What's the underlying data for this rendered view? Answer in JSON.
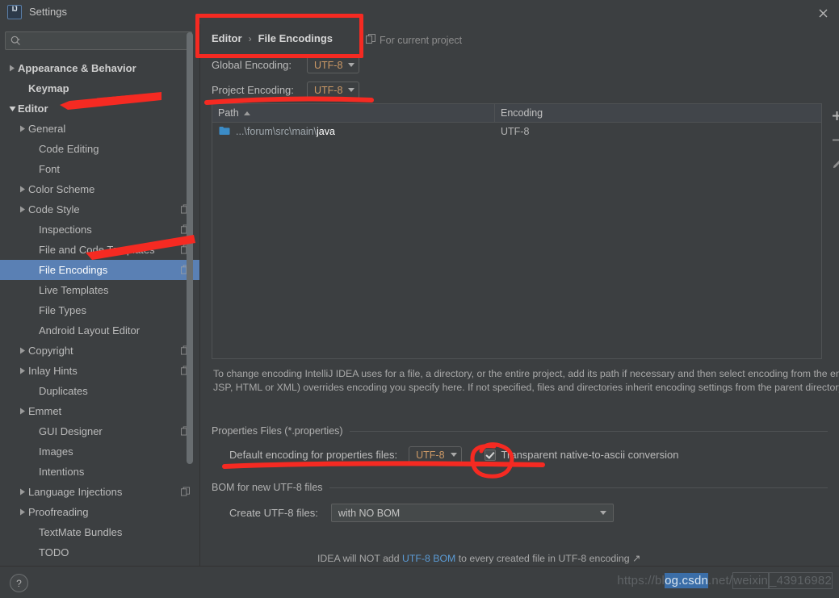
{
  "window": {
    "title": "Settings",
    "app_icon": "intellij-idea-icon",
    "close_icon": "close-icon"
  },
  "search": {
    "value": "",
    "placeholder": "",
    "icon": "search-icon"
  },
  "sidebar": {
    "scrollbar": "vertical-scrollbar",
    "items": [
      {
        "label": "Appearance & Behavior",
        "indent": 0,
        "arrow": "collapsed",
        "bold": true,
        "badge": false,
        "selected": false
      },
      {
        "label": "Keymap",
        "indent": 1,
        "arrow": "none",
        "bold": true,
        "badge": false,
        "selected": false
      },
      {
        "label": "Editor",
        "indent": 0,
        "arrow": "expanded",
        "bold": true,
        "badge": false,
        "selected": false
      },
      {
        "label": "General",
        "indent": 1,
        "arrow": "collapsed",
        "bold": false,
        "badge": false,
        "selected": false
      },
      {
        "label": "Code Editing",
        "indent": 2,
        "arrow": "none",
        "bold": false,
        "badge": false,
        "selected": false
      },
      {
        "label": "Font",
        "indent": 2,
        "arrow": "none",
        "bold": false,
        "badge": false,
        "selected": false
      },
      {
        "label": "Color Scheme",
        "indent": 1,
        "arrow": "collapsed",
        "bold": false,
        "badge": false,
        "selected": false
      },
      {
        "label": "Code Style",
        "indent": 1,
        "arrow": "collapsed",
        "bold": false,
        "badge": true,
        "selected": false
      },
      {
        "label": "Inspections",
        "indent": 2,
        "arrow": "none",
        "bold": false,
        "badge": true,
        "selected": false
      },
      {
        "label": "File and Code Templates",
        "indent": 2,
        "arrow": "none",
        "bold": false,
        "badge": true,
        "selected": false
      },
      {
        "label": "File Encodings",
        "indent": 2,
        "arrow": "none",
        "bold": false,
        "badge": true,
        "selected": true
      },
      {
        "label": "Live Templates",
        "indent": 2,
        "arrow": "none",
        "bold": false,
        "badge": false,
        "selected": false
      },
      {
        "label": "File Types",
        "indent": 2,
        "arrow": "none",
        "bold": false,
        "badge": false,
        "selected": false
      },
      {
        "label": "Android Layout Editor",
        "indent": 2,
        "arrow": "none",
        "bold": false,
        "badge": false,
        "selected": false
      },
      {
        "label": "Copyright",
        "indent": 1,
        "arrow": "collapsed",
        "bold": false,
        "badge": true,
        "selected": false
      },
      {
        "label": "Inlay Hints",
        "indent": 1,
        "arrow": "collapsed",
        "bold": false,
        "badge": true,
        "selected": false
      },
      {
        "label": "Duplicates",
        "indent": 2,
        "arrow": "none",
        "bold": false,
        "badge": false,
        "selected": false
      },
      {
        "label": "Emmet",
        "indent": 1,
        "arrow": "collapsed",
        "bold": false,
        "badge": false,
        "selected": false
      },
      {
        "label": "GUI Designer",
        "indent": 2,
        "arrow": "none",
        "bold": false,
        "badge": true,
        "selected": false
      },
      {
        "label": "Images",
        "indent": 2,
        "arrow": "none",
        "bold": false,
        "badge": false,
        "selected": false
      },
      {
        "label": "Intentions",
        "indent": 2,
        "arrow": "none",
        "bold": false,
        "badge": false,
        "selected": false
      },
      {
        "label": "Language Injections",
        "indent": 1,
        "arrow": "collapsed",
        "bold": false,
        "badge": true,
        "selected": false
      },
      {
        "label": "Proofreading",
        "indent": 1,
        "arrow": "collapsed",
        "bold": false,
        "badge": false,
        "selected": false
      },
      {
        "label": "TextMate Bundles",
        "indent": 2,
        "arrow": "none",
        "bold": false,
        "badge": false,
        "selected": false
      },
      {
        "label": "TODO",
        "indent": 2,
        "arrow": "none",
        "bold": false,
        "badge": false,
        "selected": false
      }
    ]
  },
  "main": {
    "breadcrumb": {
      "parent": "Editor",
      "separator": "›",
      "current": "File Encodings"
    },
    "for_current_project": {
      "label": "For current project",
      "icon": "project-scope-icon"
    },
    "global_encoding": {
      "label": "Global Encoding:",
      "value": "UTF-8"
    },
    "project_encoding": {
      "label": "Project Encoding:",
      "value": "UTF-8"
    },
    "table": {
      "columns": [
        "Path",
        "Encoding"
      ],
      "sort_column": "Path",
      "sort_direction": "asc",
      "rows": [
        {
          "icon": "folder-icon",
          "path_prefix": "...\\forum\\src\\main\\",
          "path_highlight": "java",
          "encoding": "UTF-8"
        }
      ],
      "toolbar": [
        {
          "name": "add-button",
          "icon": "plus-icon"
        },
        {
          "name": "remove-button",
          "icon": "minus-icon"
        },
        {
          "name": "edit-button",
          "icon": "pencil-icon"
        }
      ]
    },
    "description": "To change encoding IntelliJ IDEA uses for a file, a directory, or the entire project, add its path if necessary and then select encoding from the encoding list. Built-in file encoding (e.g. JSP, HTML or XML) overrides encoding you specify here. If not specified, files and directories inherit encoding settings from the parent directory or from the Project Encoding.",
    "properties_section": {
      "title": "Properties Files (*.properties)",
      "default_encoding_label": "Default encoding for properties files:",
      "default_encoding_value": "UTF-8",
      "transparent_checkbox": {
        "label": "Transparent native-to-ascii conversion",
        "checked": true
      }
    },
    "bom_section": {
      "title": "BOM for new UTF-8 files",
      "create_label": "Create UTF-8 files:",
      "create_value": "with NO BOM",
      "note_prefix": "IDEA will NOT add ",
      "note_link": "UTF-8 BOM",
      "note_suffix": " to every created file in UTF-8 encoding ↗"
    }
  },
  "bottom": {
    "help_icon": "question-mark-icon",
    "help_label": "?",
    "watermark_part1": "https://bl",
    "watermark_part2": "og.csdn",
    "watermark_part3": ".net/",
    "watermark_part4": "weixin",
    "watermark_part5": "_43916982"
  },
  "annotations": {
    "color": "#f52a22",
    "shapes": [
      "rect-around-breadcrumb",
      "arrow-to-editor",
      "arrow-to-file-encodings",
      "underline-under-project-encoding",
      "underline-under-default-encoding",
      "circle-around-checkbox"
    ]
  }
}
